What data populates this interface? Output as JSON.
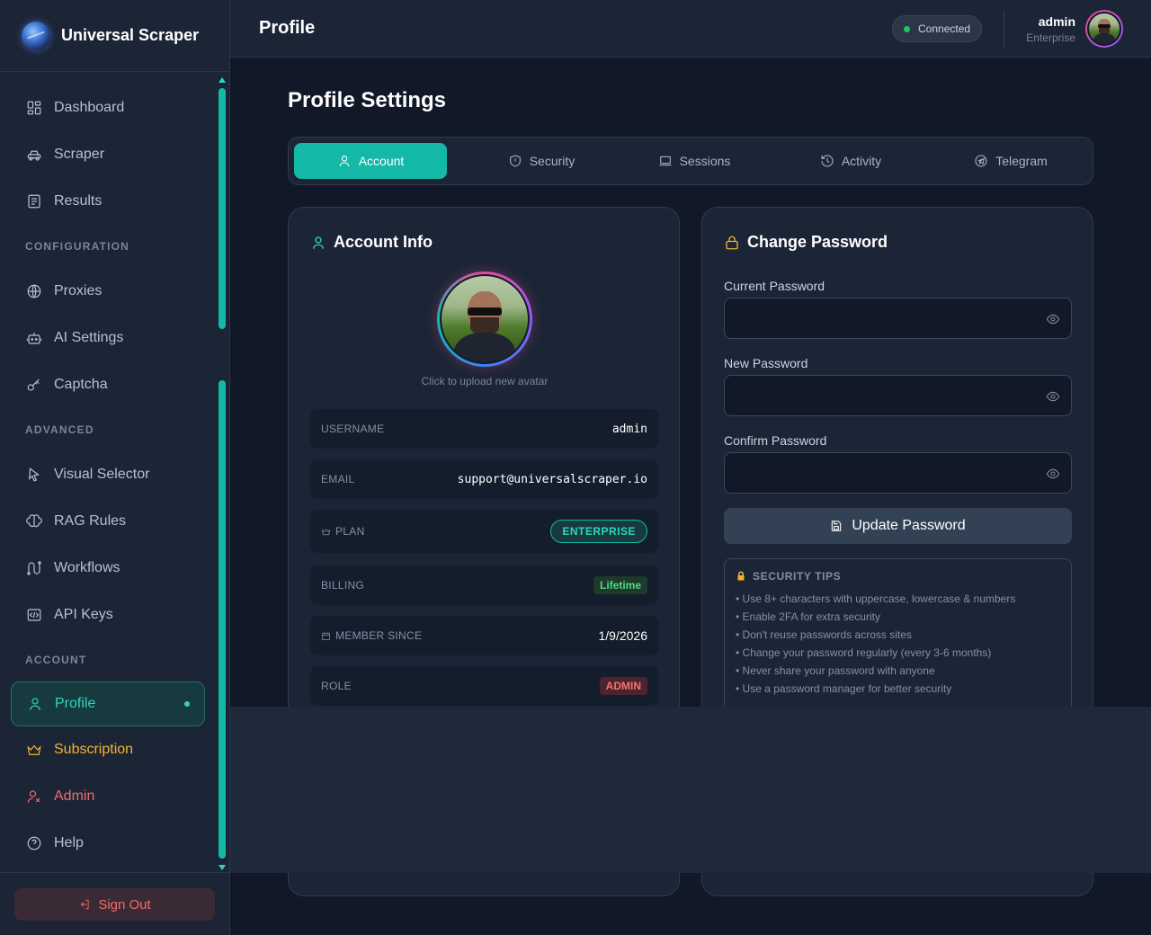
{
  "brand": {
    "title": "Universal Scraper"
  },
  "sidebar": {
    "items": [
      {
        "label": "Dashboard",
        "icon": "dashboard-icon"
      },
      {
        "label": "Scraper",
        "icon": "car-icon"
      },
      {
        "label": "Results",
        "icon": "document-icon"
      }
    ],
    "section_config": "CONFIGURATION",
    "config_items": [
      {
        "label": "Proxies",
        "icon": "globe-icon"
      },
      {
        "label": "AI Settings",
        "icon": "robot-icon"
      },
      {
        "label": "Captcha",
        "icon": "key-icon"
      }
    ],
    "section_advanced": "ADVANCED",
    "advanced_items": [
      {
        "label": "Visual Selector",
        "icon": "cursor-icon"
      },
      {
        "label": "RAG Rules",
        "icon": "brain-icon"
      },
      {
        "label": "Workflows",
        "icon": "workflow-icon"
      },
      {
        "label": "API Keys",
        "icon": "code-icon"
      }
    ],
    "section_account": "ACCOUNT",
    "account_items": [
      {
        "label": "Profile",
        "icon": "user-icon"
      },
      {
        "label": "Subscription",
        "icon": "crown-icon"
      },
      {
        "label": "Admin",
        "icon": "admin-icon"
      },
      {
        "label": "Help",
        "icon": "help-icon"
      }
    ],
    "sign_out": "Sign Out"
  },
  "header": {
    "title": "Profile",
    "status": "Connected",
    "user_name": "admin",
    "user_plan": "Enterprise"
  },
  "main": {
    "page_title": "Profile Settings",
    "tabs": [
      {
        "label": "Account",
        "icon": "user-icon"
      },
      {
        "label": "Security",
        "icon": "shield-icon"
      },
      {
        "label": "Sessions",
        "icon": "laptop-icon"
      },
      {
        "label": "Activity",
        "icon": "history-icon"
      },
      {
        "label": "Telegram",
        "icon": "telegram-icon"
      }
    ]
  },
  "account_info": {
    "title": "Account Info",
    "avatar_hint": "Click to upload new avatar",
    "rows": {
      "username_label": "USERNAME",
      "username_value": "admin",
      "email_label": "EMAIL",
      "email_value": "support@universalscraper.io",
      "plan_label": "PLAN",
      "plan_value": "ENTERPRISE",
      "billing_label": "BILLING",
      "billing_value": "Lifetime",
      "member_label": "MEMBER SINCE",
      "member_value": "1/9/2026",
      "role_label": "ROLE",
      "role_value": "ADMIN"
    }
  },
  "change_password": {
    "title": "Change Password",
    "current_label": "Current Password",
    "new_label": "New Password",
    "confirm_label": "Confirm Password",
    "current_value": "",
    "new_value": "",
    "confirm_value": "",
    "button": "Update Password",
    "tips_title": "SECURITY TIPS",
    "tips": [
      "• Use 8+ characters with uppercase, lowercase & numbers",
      "• Enable 2FA for extra security",
      "• Don't reuse passwords across sites",
      "• Change your password regularly (every 3-6 months)",
      "• Never share your password with anyone",
      "• Use a password manager for better security"
    ]
  },
  "colors": {
    "accent": "#14b8a6",
    "background": "#111827",
    "panel": "#1b2536",
    "gold": "#f3b42d",
    "danger": "#f36b6b"
  }
}
